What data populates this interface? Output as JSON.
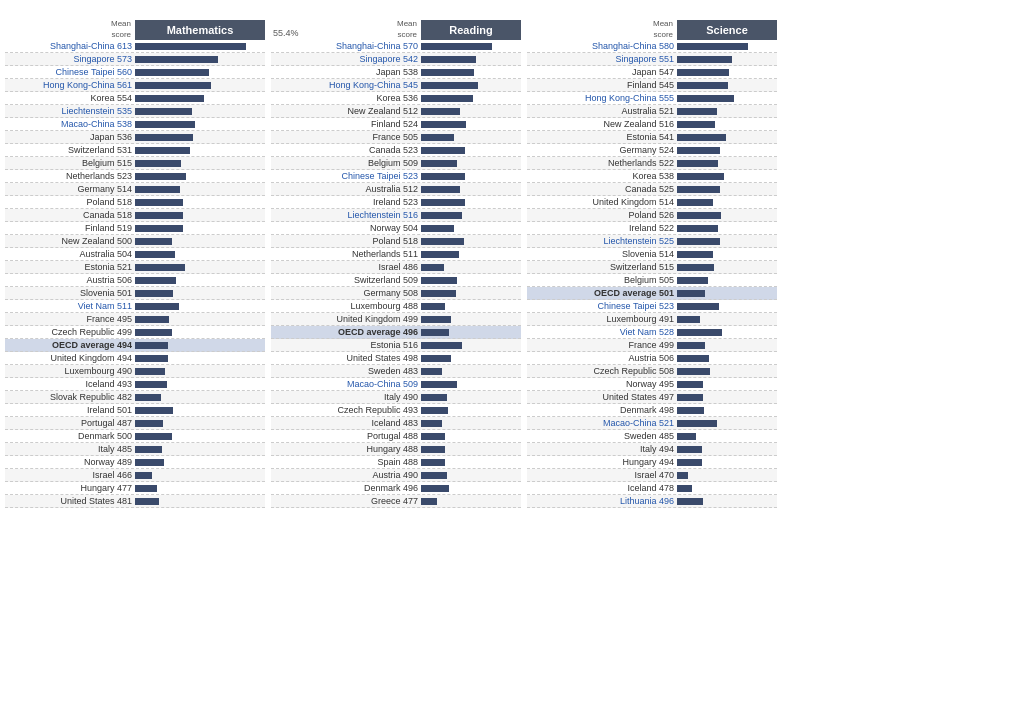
{
  "sections": {
    "math": {
      "title": "Mathematics",
      "mean_score_label": "Mean\nscore",
      "countries": [
        {
          "name": "Shanghai-China",
          "score": 613,
          "blue": true,
          "bar": 120
        },
        {
          "name": "Singapore",
          "score": 573,
          "blue": true,
          "bar": 90
        },
        {
          "name": "Chinese Taipei",
          "score": 560,
          "blue": true,
          "bar": 80
        },
        {
          "name": "Hong Kong-China",
          "score": 561,
          "blue": true,
          "bar": 82
        },
        {
          "name": "Korea",
          "score": 554,
          "blue": false,
          "bar": 75
        },
        {
          "name": "Liechtenstein",
          "score": 535,
          "blue": true,
          "bar": 62
        },
        {
          "name": "Macao-China",
          "score": 538,
          "blue": true,
          "bar": 65
        },
        {
          "name": "Japan",
          "score": 536,
          "blue": false,
          "bar": 63
        },
        {
          "name": "Switzerland",
          "score": 531,
          "blue": false,
          "bar": 60
        },
        {
          "name": "Belgium",
          "score": 515,
          "blue": false,
          "bar": 50
        },
        {
          "name": "Netherlands",
          "score": 523,
          "blue": false,
          "bar": 55
        },
        {
          "name": "Germany",
          "score": 514,
          "blue": false,
          "bar": 49
        },
        {
          "name": "Poland",
          "score": 518,
          "blue": false,
          "bar": 52
        },
        {
          "name": "Canada",
          "score": 518,
          "blue": false,
          "bar": 52
        },
        {
          "name": "Finland",
          "score": 519,
          "blue": false,
          "bar": 52
        },
        {
          "name": "New Zealand",
          "score": 500,
          "blue": false,
          "bar": 40
        },
        {
          "name": "Australia",
          "score": 504,
          "blue": false,
          "bar": 43
        },
        {
          "name": "Estonia",
          "score": 521,
          "blue": false,
          "bar": 54
        },
        {
          "name": "Austria",
          "score": 506,
          "blue": false,
          "bar": 44
        },
        {
          "name": "Slovenia",
          "score": 501,
          "blue": false,
          "bar": 41
        },
        {
          "name": "Viet Nam",
          "score": 511,
          "blue": true,
          "bar": 48
        },
        {
          "name": "France",
          "score": 495,
          "blue": false,
          "bar": 37
        },
        {
          "name": "Czech Republic",
          "score": 499,
          "blue": false,
          "bar": 40
        },
        {
          "name": "OECD average",
          "score": 494,
          "blue": false,
          "bar": 36,
          "oecd": true
        },
        {
          "name": "United Kingdom",
          "score": 494,
          "blue": false,
          "bar": 36
        },
        {
          "name": "Luxembourg",
          "score": 490,
          "blue": false,
          "bar": 33
        },
        {
          "name": "Iceland",
          "score": 493,
          "blue": false,
          "bar": 35
        },
        {
          "name": "Slovak Republic",
          "score": 482,
          "blue": false,
          "bar": 28
        },
        {
          "name": "Ireland",
          "score": 501,
          "blue": false,
          "bar": 41
        },
        {
          "name": "Portugal",
          "score": 487,
          "blue": false,
          "bar": 30
        },
        {
          "name": "Denmark",
          "score": 500,
          "blue": false,
          "bar": 40
        },
        {
          "name": "Italy",
          "score": 485,
          "blue": false,
          "bar": 29
        },
        {
          "name": "Norway",
          "score": 489,
          "blue": false,
          "bar": 32
        },
        {
          "name": "Israel",
          "score": 466,
          "blue": false,
          "bar": 18
        },
        {
          "name": "Hungary",
          "score": 477,
          "blue": false,
          "bar": 24
        },
        {
          "name": "United States",
          "score": 481,
          "blue": false,
          "bar": 26
        }
      ]
    },
    "reading": {
      "title": "Reading",
      "mean_score_label": "Mean\nscore",
      "percent": "55.4%",
      "countries": [
        {
          "name": "Shanghai-China",
          "score": 570,
          "blue": true,
          "bar": 100
        },
        {
          "name": "Singapore",
          "score": 542,
          "blue": true,
          "bar": 78
        },
        {
          "name": "Japan",
          "score": 538,
          "blue": false,
          "bar": 75
        },
        {
          "name": "Hong Kong-China",
          "score": 545,
          "blue": true,
          "bar": 80
        },
        {
          "name": "Korea",
          "score": 536,
          "blue": false,
          "bar": 73
        },
        {
          "name": "New Zealand",
          "score": 512,
          "blue": false,
          "bar": 55
        },
        {
          "name": "Finland",
          "score": 524,
          "blue": false,
          "bar": 63
        },
        {
          "name": "France",
          "score": 505,
          "blue": false,
          "bar": 47
        },
        {
          "name": "Canada",
          "score": 523,
          "blue": false,
          "bar": 62
        },
        {
          "name": "Belgium",
          "score": 509,
          "blue": false,
          "bar": 51
        },
        {
          "name": "Chinese Taipei",
          "score": 523,
          "blue": true,
          "bar": 62
        },
        {
          "name": "Australia",
          "score": 512,
          "blue": false,
          "bar": 55
        },
        {
          "name": "Ireland",
          "score": 523,
          "blue": false,
          "bar": 62
        },
        {
          "name": "Liechtenstein",
          "score": 516,
          "blue": true,
          "bar": 58
        },
        {
          "name": "Norway",
          "score": 504,
          "blue": false,
          "bar": 46
        },
        {
          "name": "Poland",
          "score": 518,
          "blue": false,
          "bar": 60
        },
        {
          "name": "Netherlands",
          "score": 511,
          "blue": false,
          "bar": 54
        },
        {
          "name": "Israel",
          "score": 486,
          "blue": false,
          "bar": 32
        },
        {
          "name": "Switzerland",
          "score": 509,
          "blue": false,
          "bar": 51
        },
        {
          "name": "Germany",
          "score": 508,
          "blue": false,
          "bar": 50
        },
        {
          "name": "Luxembourg",
          "score": 488,
          "blue": false,
          "bar": 34
        },
        {
          "name": "United Kingdom",
          "score": 499,
          "blue": false,
          "bar": 43
        },
        {
          "name": "OECD average",
          "score": 496,
          "blue": false,
          "bar": 40,
          "oecd": true
        },
        {
          "name": "Estonia",
          "score": 516,
          "blue": false,
          "bar": 58
        },
        {
          "name": "United States",
          "score": 498,
          "blue": false,
          "bar": 42
        },
        {
          "name": "Sweden",
          "score": 483,
          "blue": false,
          "bar": 29
        },
        {
          "name": "Macao-China",
          "score": 509,
          "blue": true,
          "bar": 51
        },
        {
          "name": "Italy",
          "score": 490,
          "blue": false,
          "bar": 36
        },
        {
          "name": "Czech Republic",
          "score": 493,
          "blue": false,
          "bar": 38
        },
        {
          "name": "Iceland",
          "score": 483,
          "blue": false,
          "bar": 29
        },
        {
          "name": "Portugal",
          "score": 488,
          "blue": false,
          "bar": 34
        },
        {
          "name": "Hungary",
          "score": 488,
          "blue": false,
          "bar": 34
        },
        {
          "name": "Spain",
          "score": 488,
          "blue": false,
          "bar": 34
        },
        {
          "name": "Austria",
          "score": 490,
          "blue": false,
          "bar": 36
        },
        {
          "name": "Denmark",
          "score": 496,
          "blue": false,
          "bar": 40
        },
        {
          "name": "Greece",
          "score": 477,
          "blue": false,
          "bar": 23
        }
      ]
    },
    "science": {
      "title": "Science",
      "mean_score_label": "Mean\nscore",
      "countries": [
        {
          "name": "Shanghai-China",
          "score": 580,
          "blue": true,
          "bar": 100
        },
        {
          "name": "Singapore",
          "score": 551,
          "blue": true,
          "bar": 77
        },
        {
          "name": "Japan",
          "score": 547,
          "blue": false,
          "bar": 74
        },
        {
          "name": "Finland",
          "score": 545,
          "blue": false,
          "bar": 72
        },
        {
          "name": "Hong Kong-China",
          "score": 555,
          "blue": true,
          "bar": 80
        },
        {
          "name": "Australia",
          "score": 521,
          "blue": false,
          "bar": 57
        },
        {
          "name": "New Zealand",
          "score": 516,
          "blue": false,
          "bar": 53
        },
        {
          "name": "Estonia",
          "score": 541,
          "blue": false,
          "bar": 69
        },
        {
          "name": "Germany",
          "score": 524,
          "blue": false,
          "bar": 60
        },
        {
          "name": "Netherlands",
          "score": 522,
          "blue": false,
          "bar": 58
        },
        {
          "name": "Korea",
          "score": 538,
          "blue": false,
          "bar": 66
        },
        {
          "name": "Canada",
          "score": 525,
          "blue": false,
          "bar": 61
        },
        {
          "name": "United Kingdom",
          "score": 514,
          "blue": false,
          "bar": 51
        },
        {
          "name": "Poland",
          "score": 526,
          "blue": false,
          "bar": 62
        },
        {
          "name": "Ireland",
          "score": 522,
          "blue": false,
          "bar": 58
        },
        {
          "name": "Liechtenstein",
          "score": 525,
          "blue": true,
          "bar": 61
        },
        {
          "name": "Slovenia",
          "score": 514,
          "blue": false,
          "bar": 51
        },
        {
          "name": "Switzerland",
          "score": 515,
          "blue": false,
          "bar": 52
        },
        {
          "name": "Belgium",
          "score": 505,
          "blue": false,
          "bar": 44
        },
        {
          "name": "OECD average",
          "score": 501,
          "blue": false,
          "bar": 40,
          "oecd": true
        },
        {
          "name": "Chinese Taipei",
          "score": 523,
          "blue": true,
          "bar": 59
        },
        {
          "name": "Luxembourg",
          "score": 491,
          "blue": false,
          "bar": 33
        },
        {
          "name": "Viet Nam",
          "score": 528,
          "blue": true,
          "bar": 64
        },
        {
          "name": "France",
          "score": 499,
          "blue": false,
          "bar": 39
        },
        {
          "name": "Austria",
          "score": 506,
          "blue": false,
          "bar": 45
        },
        {
          "name": "Czech Republic",
          "score": 508,
          "blue": false,
          "bar": 47
        },
        {
          "name": "Norway",
          "score": 495,
          "blue": false,
          "bar": 36
        },
        {
          "name": "United States",
          "score": 497,
          "blue": false,
          "bar": 37
        },
        {
          "name": "Denmark",
          "score": 498,
          "blue": false,
          "bar": 38
        },
        {
          "name": "Macao-China",
          "score": 521,
          "blue": true,
          "bar": 57
        },
        {
          "name": "Sweden",
          "score": 485,
          "blue": false,
          "bar": 27
        },
        {
          "name": "Italy",
          "score": 494,
          "blue": false,
          "bar": 35
        },
        {
          "name": "Hungary",
          "score": 494,
          "blue": false,
          "bar": 35
        },
        {
          "name": "Israel",
          "score": 470,
          "blue": false,
          "bar": 15
        },
        {
          "name": "Iceland",
          "score": 478,
          "blue": false,
          "bar": 21
        },
        {
          "name": "Lithuania",
          "score": 496,
          "blue": true,
          "bar": 37
        }
      ]
    }
  }
}
